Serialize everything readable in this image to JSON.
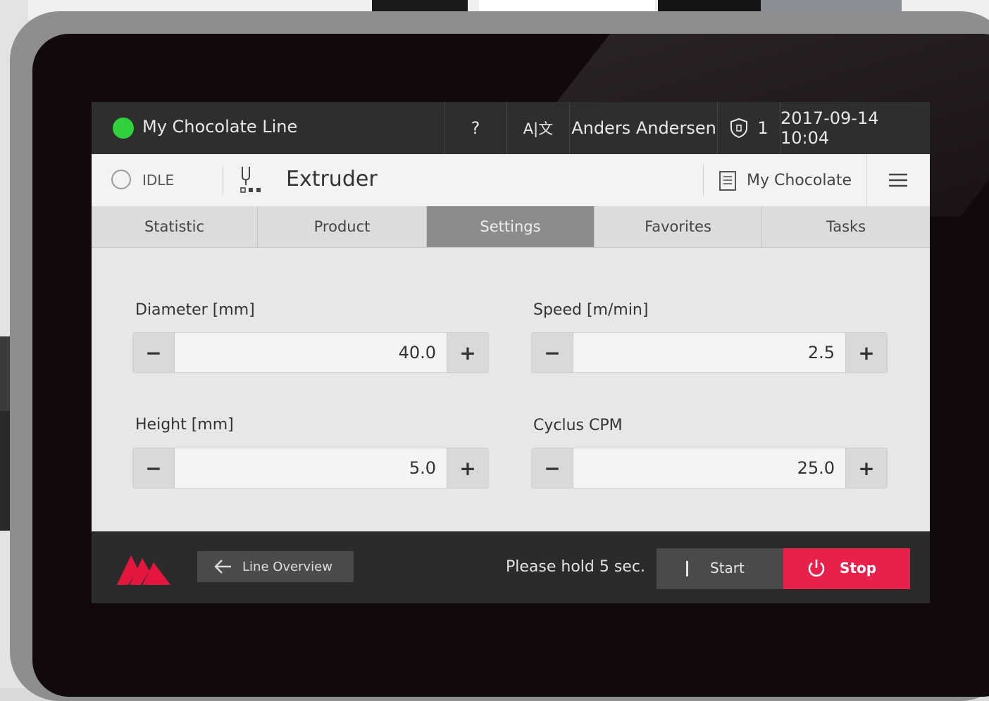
{
  "header": {
    "line_name": "My Chocolate Line",
    "help_label": "?",
    "language_label": "A|文",
    "user_name": "Anders Andersen",
    "alarm_count": "1",
    "datetime": "2017-09-14 10:04"
  },
  "machine": {
    "status": "IDLE",
    "name": "Extruder",
    "recipe": "My Chocolate"
  },
  "tabs": [
    {
      "label": "Statistic",
      "active": false
    },
    {
      "label": "Product",
      "active": false
    },
    {
      "label": "Settings",
      "active": true
    },
    {
      "label": "Favorites",
      "active": false
    },
    {
      "label": "Tasks",
      "active": false
    }
  ],
  "settings": {
    "diameter": {
      "label": "Diameter [mm]",
      "value": "40.0"
    },
    "speed": {
      "label": "Speed [m/min]",
      "value": "2.5"
    },
    "height": {
      "label": "Height [mm]",
      "value": "5.0"
    },
    "cyclus": {
      "label": "Cyclus CPM",
      "value": "25.0"
    },
    "minus_symbol": "−",
    "plus_symbol": "+"
  },
  "footer": {
    "line_overview_label": "Line Overview",
    "hold_text": "Please hold 5 sec.",
    "start_label": "Start",
    "stop_label": "Stop"
  },
  "colors": {
    "status_ok": "#2fd13c",
    "stop_red": "#e8214c",
    "brand_red": "#e3173e"
  },
  "icons": [
    "help-icon",
    "language-icon",
    "shield-icon",
    "extruder-icon",
    "recipe-icon",
    "menu-icon",
    "arrow-left-icon",
    "power-icon"
  ]
}
